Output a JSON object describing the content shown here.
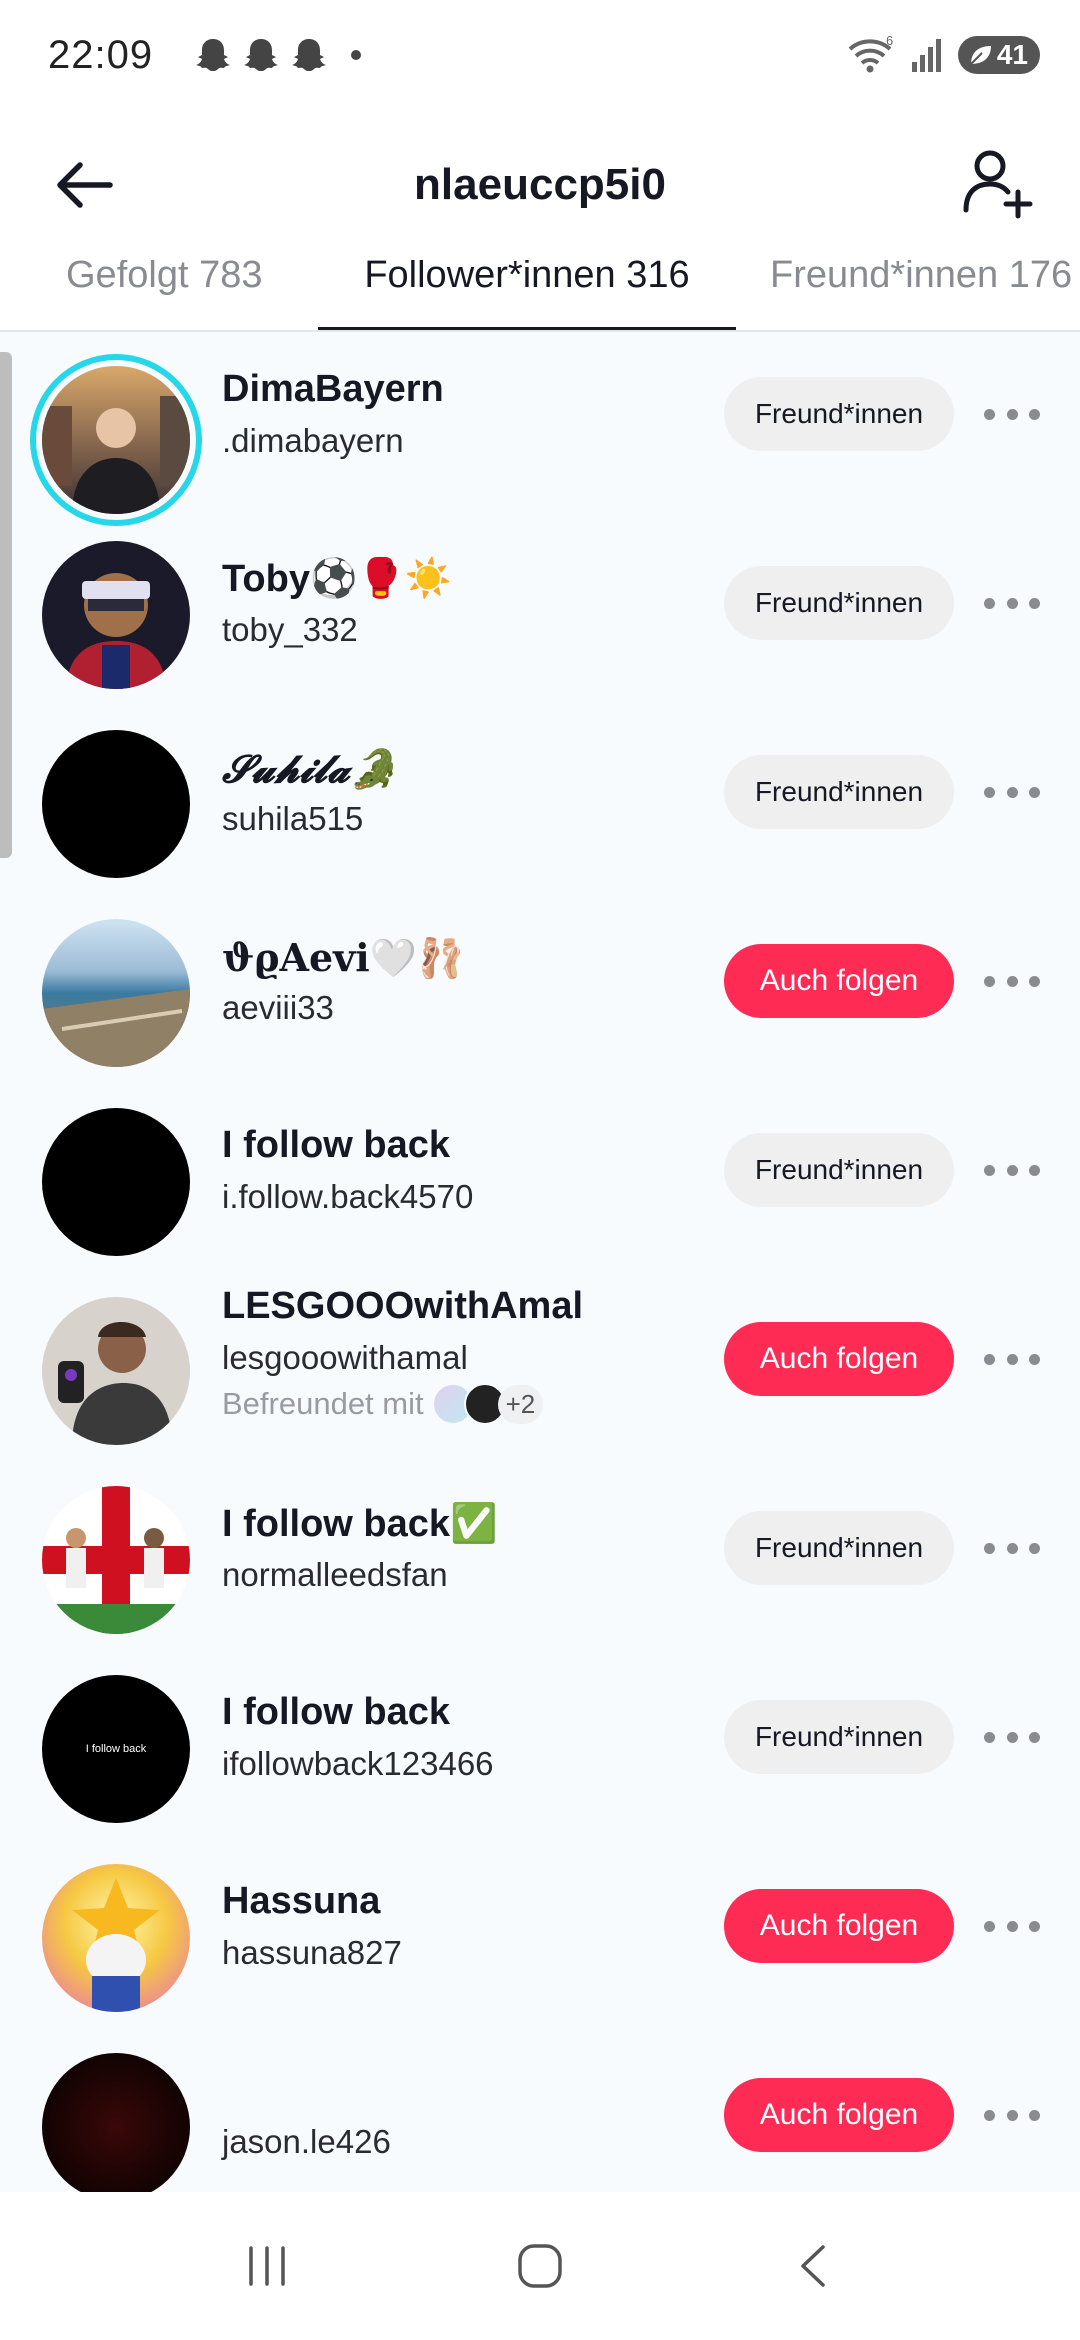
{
  "status_bar": {
    "time": "22:09",
    "battery": "41",
    "wifi_badge": "6",
    "icons": [
      "snapchat-ghost-icon",
      "snapchat-ghost-icon",
      "snapchat-ghost-icon",
      "wifi-icon",
      "signal-icon",
      "battery-icon"
    ]
  },
  "header": {
    "title": "nlaeuccp5i0",
    "back_icon": "arrow-left-icon",
    "add_icon": "add-user-icon"
  },
  "tabs": [
    {
      "label": "Gefolgt 783",
      "active": false
    },
    {
      "label": "Follower*innen 316",
      "active": true
    },
    {
      "label": "Freund*innen 176",
      "active": false
    }
  ],
  "followers": [
    {
      "name": "DimaBayern",
      "handle": ".dimabayern",
      "button": "Freund*innen",
      "button_type": "friends",
      "story_ring": true
    },
    {
      "name": "Toby⚽🥊☀️",
      "handle": "toby_332",
      "button": "Freund*innen",
      "button_type": "friends"
    },
    {
      "name": "𝓢𝓾𝓱𝓲𝓵𝓪🐊",
      "handle": "suhila515",
      "button": "Freund*innen",
      "button_type": "friends"
    },
    {
      "name": "ϑϱAevi🤍🩰",
      "handle": "aeviii33",
      "button": "Auch folgen",
      "button_type": "follow"
    },
    {
      "name": "I follow back",
      "handle": "i.follow.back4570",
      "button": "Freund*innen",
      "button_type": "friends"
    },
    {
      "name": "LESGOOOwithAmal",
      "handle": "lesgooowithamal",
      "mutual": "Befreundet mit",
      "mutual_more": "+2",
      "button": "Auch folgen",
      "button_type": "follow"
    },
    {
      "name": "I follow back✅",
      "handle": "normalleedsfan",
      "button": "Freund*innen",
      "button_type": "friends"
    },
    {
      "name": "I follow back",
      "handle": "ifollowback123466",
      "button": "Freund*innen",
      "button_type": "friends",
      "avatar_text": "I follow back"
    },
    {
      "name": "Hassuna",
      "handle": "hassuna827",
      "button": "Auch folgen",
      "button_type": "follow"
    },
    {
      "name": "",
      "handle": "jason.le426",
      "button": "Auch folgen",
      "button_type": "follow"
    }
  ],
  "colors": {
    "accent": "#fe2c55",
    "story_ring": "#25d7e8",
    "list_background": "#f7fbfd"
  },
  "nav": {
    "recents_icon": "recent-apps-icon",
    "home_icon": "home-icon",
    "back_icon": "nav-back-icon"
  }
}
